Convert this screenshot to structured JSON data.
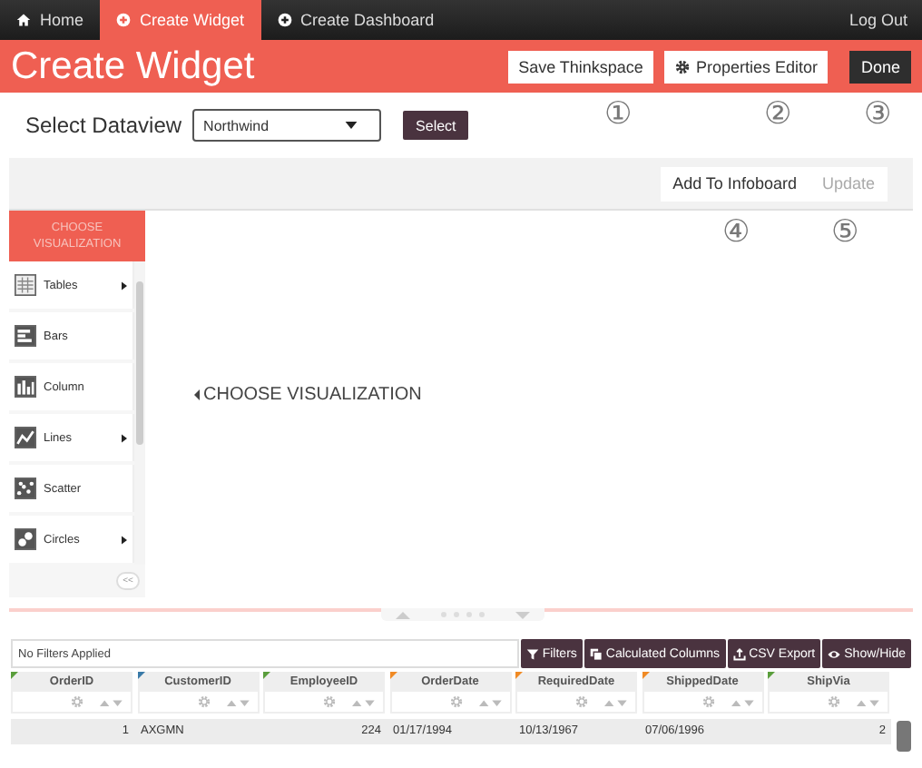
{
  "nav": {
    "tabs": [
      {
        "label": "Home",
        "kind": "home",
        "selected": false
      },
      {
        "label": "Create Widget",
        "kind": "create",
        "selected": true
      },
      {
        "label": "Create Dashboard",
        "kind": "create",
        "selected": false
      }
    ],
    "logout": "Log Out"
  },
  "header": {
    "title": "Create Widget",
    "buttons": [
      {
        "label": "Save Thinkspace",
        "kind": "light",
        "callout": "①"
      },
      {
        "label": "Properties Editor",
        "kind": "gear",
        "callout": "②"
      },
      {
        "label": "Done",
        "kind": "dark",
        "callout": "③"
      }
    ]
  },
  "dataview": {
    "label": "Select Dataview",
    "value": "Northwind",
    "button": "Select"
  },
  "toolbar": {
    "buttons": [
      {
        "label": "Add To Infoboard",
        "disabled": false,
        "callout": "④"
      },
      {
        "label": "Update",
        "disabled": true,
        "callout": "⑤"
      }
    ]
  },
  "sidebar": {
    "title": "CHOOSE VISUALIZATION",
    "items": [
      {
        "label": "Tables",
        "kind": "table",
        "submenu": true
      },
      {
        "label": "Bars",
        "kind": "bars",
        "submenu": false
      },
      {
        "label": "Column",
        "kind": "column",
        "submenu": false
      },
      {
        "label": "Lines",
        "kind": "lines",
        "submenu": true
      },
      {
        "label": "Scatter",
        "kind": "scatter",
        "submenu": false
      },
      {
        "label": "Circles",
        "kind": "circles",
        "submenu": true
      }
    ],
    "collapse": "<<"
  },
  "canvas": {
    "hint": "CHOOSE VISUALIZATION"
  },
  "grid": {
    "filter_status": "No Filters Applied",
    "buttons": [
      {
        "label": "Filters",
        "kind": "filter"
      },
      {
        "label": "Calculated Columns",
        "kind": "copy"
      },
      {
        "label": "CSV Export",
        "kind": "export"
      },
      {
        "label": "Show/Hide",
        "kind": "eye"
      }
    ],
    "columns": [
      {
        "name": "OrderID",
        "color": "#5a9e3c"
      },
      {
        "name": "CustomerID",
        "color": "#3a7aa8"
      },
      {
        "name": "EmployeeID",
        "color": "#5a9e3c"
      },
      {
        "name": "OrderDate",
        "color": "#f08a24"
      },
      {
        "name": "RequiredDate",
        "color": "#f08a24"
      },
      {
        "name": "ShippedDate",
        "color": "#f08a24"
      },
      {
        "name": "ShipVia",
        "color": "#5a9e3c"
      }
    ],
    "rows": [
      [
        {
          "value": "1",
          "kind": "number"
        },
        {
          "value": "AXGMN",
          "kind": "text"
        },
        {
          "value": "224",
          "kind": "number"
        },
        {
          "value": "01/17/1994",
          "kind": "text"
        },
        {
          "value": "10/13/1967",
          "kind": "text"
        },
        {
          "value": "07/06/1996",
          "kind": "text"
        },
        {
          "value": "2",
          "kind": "number"
        }
      ]
    ]
  }
}
